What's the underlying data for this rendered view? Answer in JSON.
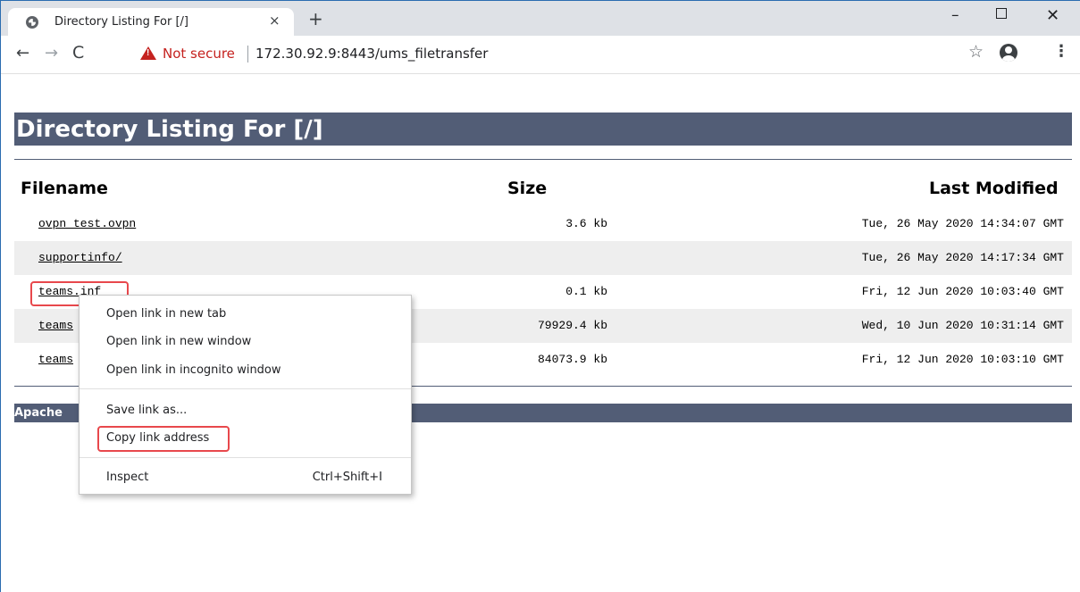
{
  "browser": {
    "tab_title": "Directory Listing For [/]",
    "tab_close": "×",
    "new_tab": "+",
    "window_controls": {
      "minimize": "–",
      "close": "✕"
    },
    "nav": {
      "back": "←",
      "forward": "→",
      "reload": "C"
    },
    "security_warning": "Not secure",
    "url": "172.30.92.9:8443/ums_filetransfer",
    "star": "☆",
    "menu": "⋮"
  },
  "page": {
    "title": "Directory Listing For [/]",
    "columns": {
      "filename": "Filename",
      "size": "Size",
      "modified": "Last Modified"
    },
    "rows": [
      {
        "name": "ovpn_test.ovpn",
        "size": "3.6 kb",
        "modified": "Tue, 26 May 2020 14:34:07 GMT"
      },
      {
        "name": "supportinfo/",
        "size": "",
        "modified": "Tue, 26 May 2020 14:17:34 GMT"
      },
      {
        "name": "teams.inf",
        "size": "0.1 kb",
        "modified": "Fri, 12 Jun 2020 10:03:40 GMT"
      },
      {
        "name": "teams",
        "size": "79929.4 kb",
        "modified": "Wed, 10 Jun 2020 10:31:14 GMT"
      },
      {
        "name": "teams",
        "size": "84073.9 kb",
        "modified": "Fri, 12 Jun 2020 10:03:10 GMT"
      }
    ],
    "footer": "Apache"
  },
  "context_menu": {
    "items": [
      "Open link in new tab",
      "Open link in new window",
      "Open link in incognito window",
      "Save link as...",
      "Copy link address",
      "Inspect"
    ],
    "inspect_shortcut": "Ctrl+Shift+I"
  },
  "colors": {
    "header_bar": "#525d76",
    "highlight": "#e8484c",
    "warning": "#c5221f"
  }
}
